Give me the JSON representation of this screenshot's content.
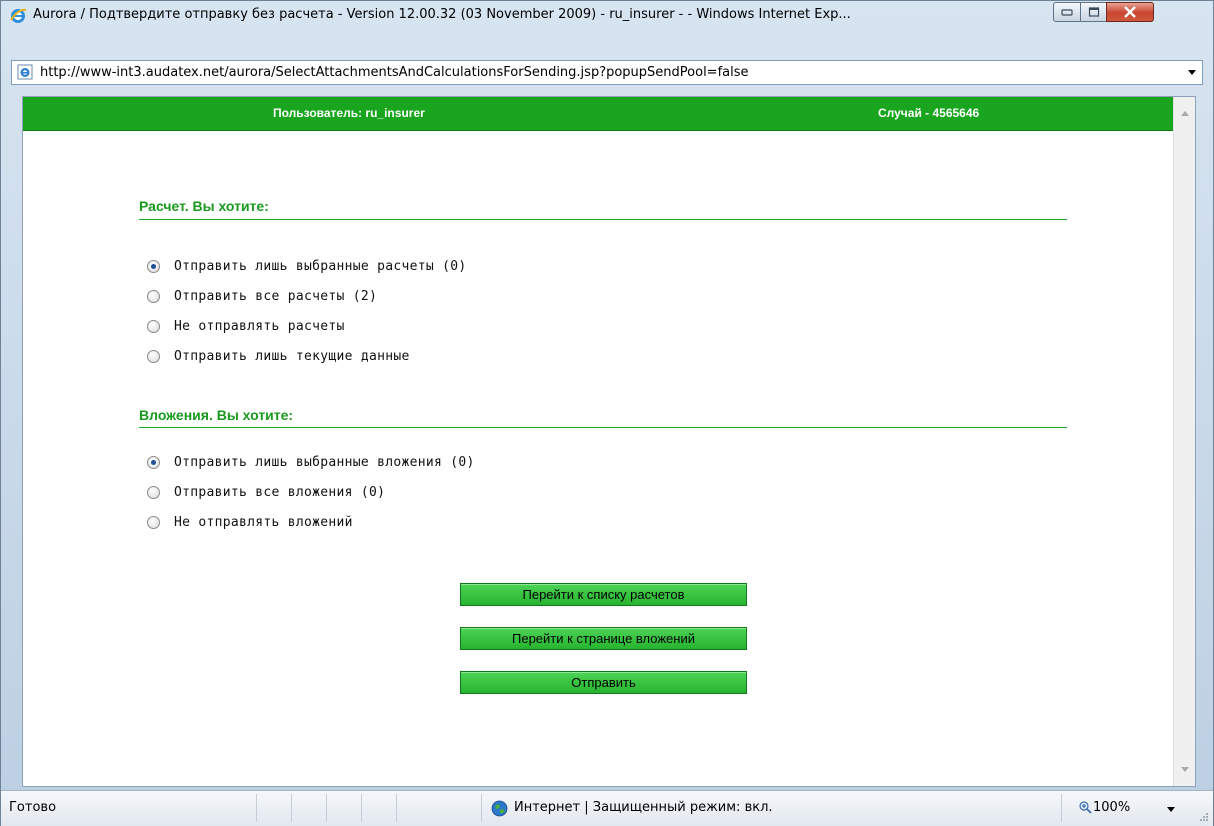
{
  "window": {
    "title": "Aurora / Подтвердите отправку без расчета - Version 12.00.32 (03 November 2009) - ru_insurer -  - Windows Internet Exp...",
    "url": "http://www-int3.audatex.net/aurora/SelectAttachmentsAndCalculationsForSending.jsp?popupSendPool=false"
  },
  "header": {
    "user": "Пользователь: ru_insurer",
    "case": "Случай - 4565646",
    "accent_color": "#1aa51f"
  },
  "calculations": {
    "title": "Расчет. Вы хотите:",
    "options": [
      {
        "label": "Отправить лишь выбранные расчеты (0)",
        "checked": true
      },
      {
        "label": "Отправить все расчеты (2)",
        "checked": false
      },
      {
        "label": "Не отправлять расчеты",
        "checked": false
      },
      {
        "label": "Отправить лишь текущие данные",
        "checked": false
      }
    ]
  },
  "attachments": {
    "title": "Вложения. Вы хотите:",
    "options": [
      {
        "label": "Отправить лишь выбранные вложения (0)",
        "checked": true
      },
      {
        "label": "Отправить все вложения (0)",
        "checked": false
      },
      {
        "label": "Не отправлять вложений",
        "checked": false
      }
    ]
  },
  "buttons": {
    "calc_list": "Перейти к списку расчетов",
    "attachments_page": "Перейти к странице вложений",
    "send": "Отправить"
  },
  "statusbar": {
    "status": "Готово",
    "zone": "Интернет | Защищенный режим: вкл.",
    "zoom": "100%"
  },
  "icons": {
    "browser": "ie-icon",
    "page": "ie-page-icon",
    "zone": "globe-icon",
    "zoom": "magnifier-icon"
  }
}
